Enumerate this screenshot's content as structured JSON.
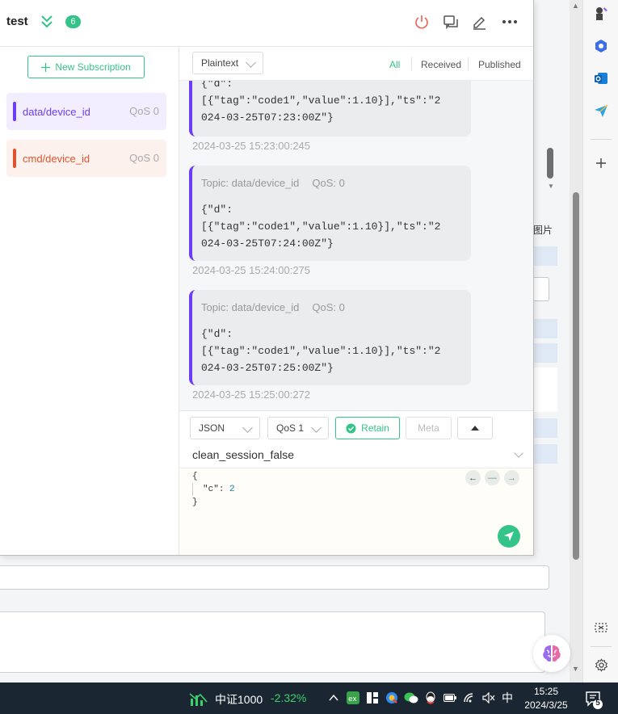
{
  "connection": {
    "name": "test",
    "badge": "6"
  },
  "subscriptions": {
    "new_button": "New Subscription",
    "items": [
      {
        "topic": "data/device_id",
        "qos": "QoS 0",
        "color": "#6d3cf5",
        "bg": "#f3eeff"
      },
      {
        "topic": "cmd/device_id",
        "qos": "QoS 0",
        "color": "#e0542d",
        "bg": "#fdf1ee"
      }
    ]
  },
  "toolbar": {
    "format": "Plaintext",
    "tabs": [
      "All",
      "Received",
      "Published"
    ]
  },
  "messages": [
    {
      "topic": "",
      "qos": "",
      "body": "{\"d\":\n[{\"tag\":\"code1\",\"value\":1.10}],\"ts\":\"2\n024-03-25T07:23:00Z\"}",
      "time": "2024-03-25 15:23:00:245"
    },
    {
      "topic": "Topic: data/device_id",
      "qos": "QoS: 0",
      "body": "{\"d\":\n[{\"tag\":\"code1\",\"value\":1.10}],\"ts\":\"2\n024-03-25T07:24:00Z\"}",
      "time": "2024-03-25 15:24:00:275"
    },
    {
      "topic": "Topic: data/device_id",
      "qos": "QoS: 0",
      "body": "{\"d\":\n[{\"tag\":\"code1\",\"value\":1.10}],\"ts\":\"2\n024-03-25T07:25:00Z\"}",
      "time": "2024-03-25 15:25:00:272"
    }
  ],
  "publish": {
    "payload_format": "JSON",
    "qos": "QoS 1",
    "retain_label": "Retain",
    "meta_label": "Meta",
    "topic": "clean_session_false",
    "payload": {
      "open": "{",
      "key": "\"c\"",
      "value": "2",
      "close": "}"
    }
  },
  "background": {
    "label": "图片"
  },
  "taskbar": {
    "stock_name": "中证1000",
    "stock_change": "-2.32%",
    "ime": "中",
    "time": "15:25",
    "date": "2024/3/25",
    "notifications": "5"
  },
  "colors": {
    "accent": "#34c388",
    "subscription_purple": "#6d3cf5",
    "subscription_red": "#e0542d"
  }
}
